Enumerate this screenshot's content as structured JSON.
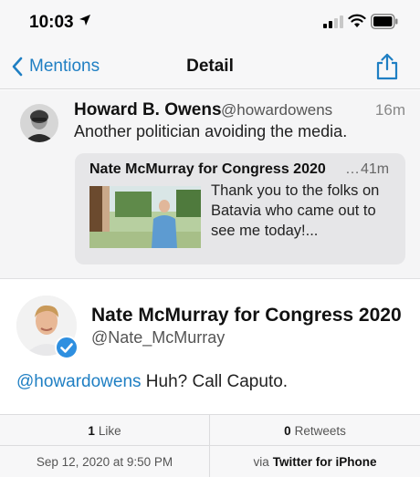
{
  "status_bar": {
    "time": "10:03",
    "icons": [
      "location-arrow-icon",
      "signal-bars-icon",
      "wifi-icon",
      "battery-icon"
    ]
  },
  "nav": {
    "back_label": "Mentions",
    "title": "Detail",
    "share_icon": "share-icon"
  },
  "parent_tweet": {
    "name": "Howard B. Owens",
    "handle": "@howardowens",
    "time": "16m",
    "text": "Another politician avoiding the media.",
    "quoted": {
      "name": "Nate McMurray for Congress 2020",
      "ellipsis": "…",
      "time": "41m",
      "text": "Thank you to the folks on Batavia who came out to see me today!..."
    }
  },
  "main_tweet": {
    "name": "Nate McMurray for Congress 2020",
    "handle": "@Nate_McMurray",
    "verified_icon": "verified-badge-icon",
    "mention": "@howardowens",
    "text": " Huh? Call Caputo."
  },
  "stats": {
    "likes_count": "1",
    "likes_label": "Like",
    "retweets_count": "0",
    "retweets_label": "Retweets",
    "date": "Sep 12, 2020 at 9:50 PM",
    "via_prefix": "via",
    "via_app": "Twitter for iPhone"
  },
  "colors": {
    "accent": "#1f7fc3",
    "background": "#ffffff",
    "panel": "#f7f7f8"
  }
}
